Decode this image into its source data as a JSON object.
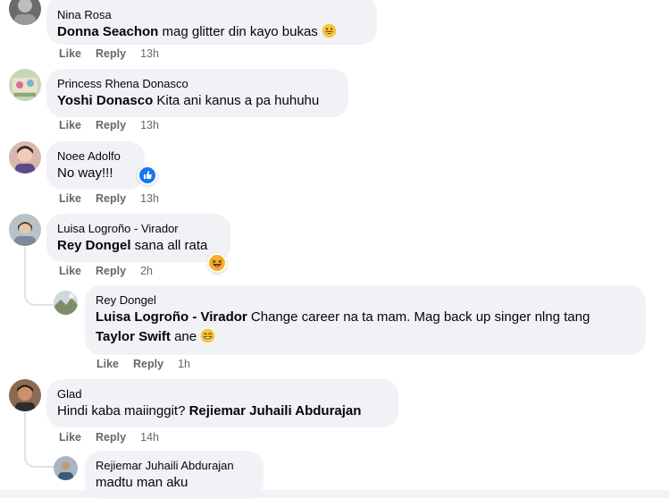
{
  "actions": {
    "like": "Like",
    "reply": "Reply"
  },
  "comments": [
    {
      "author": "Nina Rosa",
      "mention": "Donna Seachon",
      "text": " mag glitter din kayo bukas ",
      "emoji": "grinning-emoji",
      "time": "13h"
    },
    {
      "author": "Princess Rhena Donasco",
      "mention": "Yoshi Donasco",
      "text": " Kita ani kanus a pa huhuhu",
      "time": "13h"
    },
    {
      "author": "Noee Adolfo",
      "text": "No way!!!",
      "reaction": "like-reaction-icon",
      "time": "13h"
    },
    {
      "author": "Luisa Logroño - Virador",
      "mention": "Rey Dongel",
      "text": " sana all rata",
      "reaction": "haha-reaction-icon",
      "time": "2h"
    },
    {
      "author": "Rey Dongel",
      "mention": "Luisa Logroño - Virador",
      "text": " Change career na ta mam. Mag back up singer nlng tang",
      "mention2": "Taylor Swift",
      "text2": " ane ",
      "emoji": "grinning-emoji",
      "time": "1h"
    },
    {
      "author": "Glad",
      "text": "Hindi kaba maiinggit? ",
      "mention": "Rejiemar Juhaili Abdurajan",
      "time": "14h"
    },
    {
      "author": "Rejiemar Juhaili Abdurajan",
      "text": "madtu man aku"
    }
  ]
}
